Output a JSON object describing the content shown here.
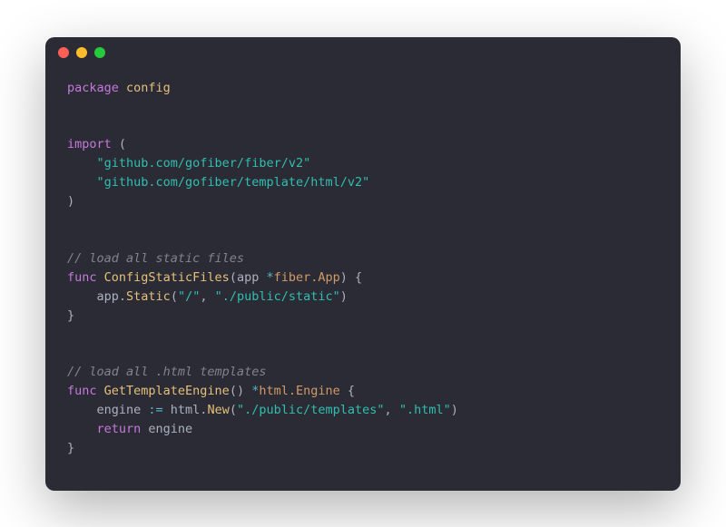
{
  "code": {
    "line1_kw": "package",
    "line1_pkg": " config",
    "line4_kw": "import",
    "line4_paren": " (",
    "line5_str": "    \"github.com/gofiber/fiber/v2\"",
    "line6_str": "    \"github.com/gofiber/template/html/v2\"",
    "line7_paren": ")",
    "line10_com": "// load all static files",
    "line11_kw": "func",
    "line11_fn": " ConfigStaticFiles",
    "line11_rest1": "(app ",
    "line11_op": "*",
    "line11_type": "fiber.App",
    "line11_rest2": ") {",
    "line12_a": "    app.",
    "line12_fn": "Static",
    "line12_p1": "(",
    "line12_s1": "\"/\"",
    "line12_c": ", ",
    "line12_s2": "\"./public/static\"",
    "line12_p2": ")",
    "line13": "}",
    "line16_com": "// load all .html templates",
    "line17_kw": "func",
    "line17_fn": " GetTemplateEngine",
    "line17_rest1": "() ",
    "line17_op": "*",
    "line17_type": "html.Engine",
    "line17_rest2": " {",
    "line18_a": "    engine ",
    "line18_op": ":=",
    "line18_b": " html.",
    "line18_fn": "New",
    "line18_p1": "(",
    "line18_s1": "\"./public/templates\"",
    "line18_c": ", ",
    "line18_s2": "\".html\"",
    "line18_p2": ")",
    "line19_kw": "    return",
    "line19_rest": " engine",
    "line20": "}"
  }
}
